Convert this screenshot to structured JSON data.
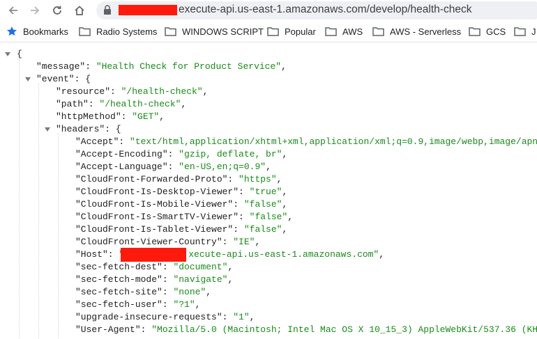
{
  "browser": {
    "url_visible": "execute-api.us-east-1.amazonaws.com/develop/health-check"
  },
  "bookmarks": [
    {
      "label": "Bookmarks",
      "icon": "star-icon"
    },
    {
      "label": "Radio Systems",
      "icon": "folder-icon"
    },
    {
      "label": "WINDOWS SCRIPT",
      "icon": "folder-icon"
    },
    {
      "label": "Popular",
      "icon": "folder-icon"
    },
    {
      "label": "AWS",
      "icon": "folder-icon"
    },
    {
      "label": "AWS - Serverless",
      "icon": "folder-icon"
    },
    {
      "label": "GCS",
      "icon": "folder-icon"
    },
    {
      "label": "J",
      "icon": "folder-icon"
    }
  ],
  "json": {
    "message": "\"Health Check for Product Service\"",
    "resource": "\"/health-check\"",
    "path": "\"/health-check\"",
    "httpMethod": "\"GET\"",
    "headers": {
      "accept": "\"text/html,application/xhtml+xml,application/xml;q=0.9,image/webp,image/apng",
      "accept_encoding": "\"gzip, deflate, br\"",
      "accept_language": "\"en-US,en;q=0.9\"",
      "cf_forwarded_proto": "\"https\"",
      "cf_is_desktop": "\"true\"",
      "cf_is_mobile": "\"false\"",
      "cf_is_smarttv": "\"false\"",
      "cf_is_tablet": "\"false\"",
      "cf_country": "\"IE\"",
      "host_visible": "xecute-api.us-east-1.amazonaws.com\"",
      "sec_fetch_dest": "\"document\"",
      "sec_fetch_mode": "\"navigate\"",
      "sec_fetch_site": "\"none\"",
      "sec_fetch_user": "\"?1\"",
      "upgrade_insecure": "\"1\"",
      "user_agent": "\"Mozilla/5.0 (Macintosh; Intel Mac OS X 10_15_3) AppleWebKit/537.36 (KH"
    }
  },
  "colors": {
    "string": "#1a8a1a",
    "redaction": "#ff1a0d"
  }
}
